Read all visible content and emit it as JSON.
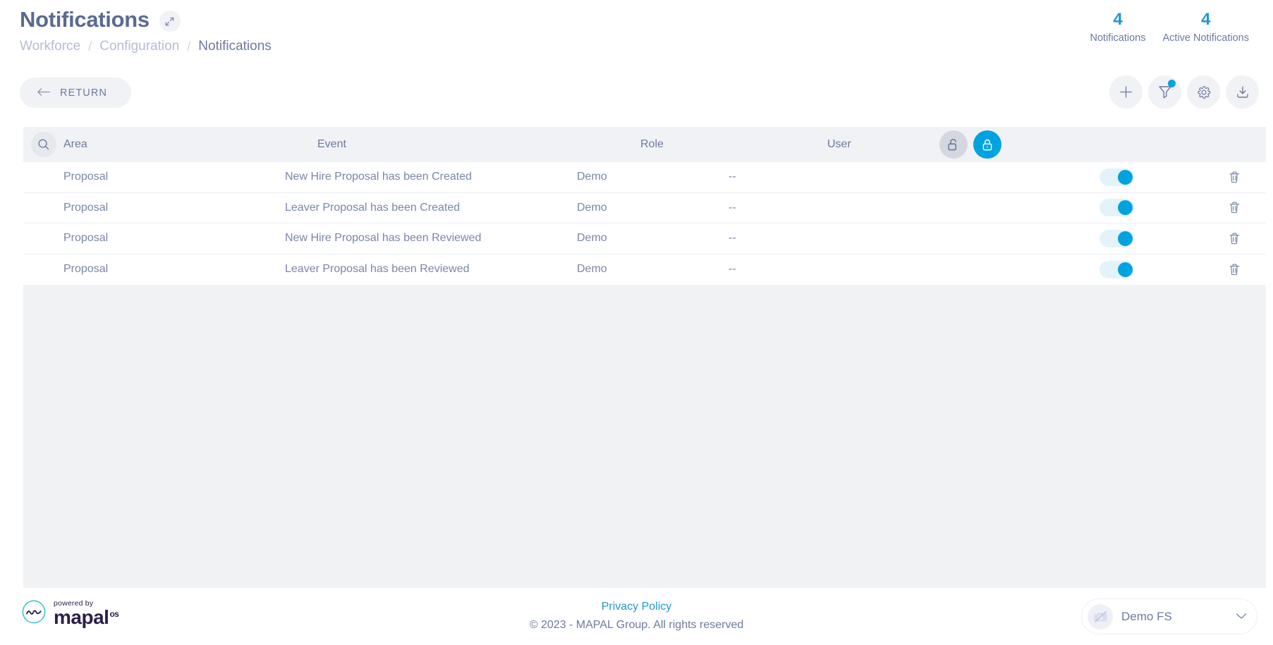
{
  "header": {
    "title": "Notifications",
    "expand_icon": "expand-arrows-icon",
    "breadcrumb": [
      {
        "label": "Workforce",
        "active": false
      },
      {
        "label": "Configuration",
        "active": false
      },
      {
        "label": "Notifications",
        "active": true
      }
    ],
    "separator": "/",
    "stats": [
      {
        "value": "4",
        "label": "Notifications"
      },
      {
        "value": "4",
        "label": "Active Notifications"
      }
    ]
  },
  "actions": {
    "return_label": "RETURN",
    "return_icon": "arrow-left-icon",
    "toolbar": [
      {
        "name": "add-button",
        "icon": "plus-icon",
        "badge": false
      },
      {
        "name": "filter-button",
        "icon": "filter-icon",
        "badge": true
      },
      {
        "name": "settings-button",
        "icon": "gear-icon",
        "badge": false
      },
      {
        "name": "download-button",
        "icon": "download-icon",
        "badge": false
      }
    ]
  },
  "table": {
    "search_icon": "search-icon",
    "columns": [
      "Area",
      "Event",
      "Role",
      "User"
    ],
    "lock_toggle": {
      "unlocked": {
        "icon": "unlock-icon",
        "active": false
      },
      "locked": {
        "icon": "lock-icon",
        "active": true
      }
    },
    "rows": [
      {
        "area": "Proposal",
        "event": "New Hire Proposal has been Created",
        "role": "Demo",
        "user": "--",
        "enabled": true,
        "delete_icon": "trash-icon"
      },
      {
        "area": "Proposal",
        "event": "Leaver Proposal has been Created",
        "role": "Demo",
        "user": "--",
        "enabled": true,
        "delete_icon": "trash-icon"
      },
      {
        "area": "Proposal",
        "event": "New Hire Proposal has been Reviewed",
        "role": "Demo",
        "user": "--",
        "enabled": true,
        "delete_icon": "trash-icon"
      },
      {
        "area": "Proposal",
        "event": "Leaver Proposal has been Reviewed",
        "role": "Demo",
        "user": "--",
        "enabled": true,
        "delete_icon": "trash-icon"
      }
    ]
  },
  "footer": {
    "powered_by": "powered by",
    "brand_name": "mapal",
    "brand_suffix": "os",
    "brand_icon": "mapal-logo-icon",
    "privacy_policy": "Privacy Policy",
    "copyright": "© 2023 - MAPAL Group. All rights reserved",
    "site_selector": {
      "name": "Demo FS",
      "avatar_icon": "no-image-icon",
      "chevron_icon": "chevron-down-icon"
    }
  },
  "colors": {
    "accent": "#00a3e0",
    "accent_text": "#2196d3",
    "text": "#6b7a9e",
    "muted": "#b4bdd3",
    "panel": "#f1f2f5"
  }
}
